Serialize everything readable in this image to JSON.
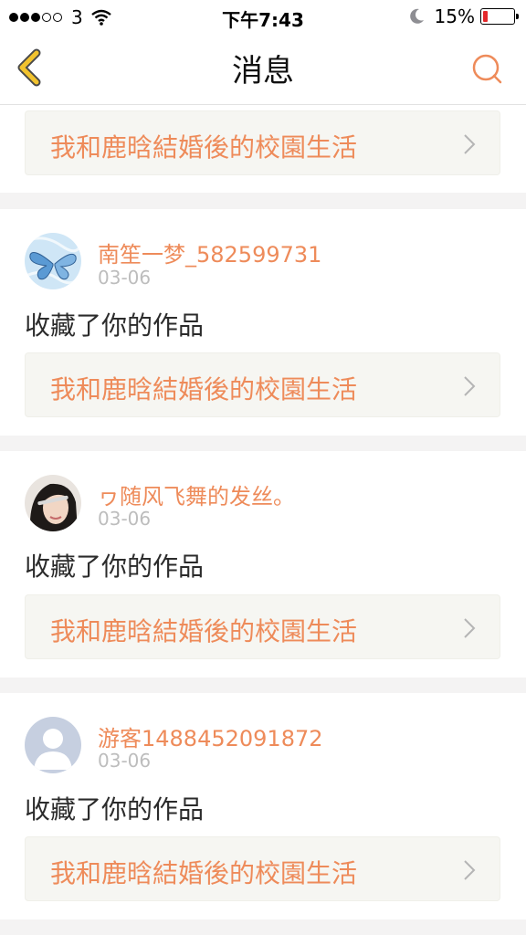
{
  "status": {
    "carrier": "3",
    "time": "下午7:43",
    "battery": "15%",
    "battery_level": 0.15
  },
  "nav": {
    "title": "消息"
  },
  "top_link": {
    "title": "我和鹿晗結婚後的校園生活"
  },
  "messages": [
    {
      "user": "南笙一梦_582599731",
      "date": "03-06",
      "action": "收藏了你的作品",
      "work": "我和鹿晗結婚後的校園生活"
    },
    {
      "user": "ヮ随风飞舞的发丝。",
      "date": "03-06",
      "action": "收藏了你的作品",
      "work": "我和鹿晗結婚後的校園生活"
    },
    {
      "user": "游客1488452091872",
      "date": "03-06",
      "action": "收藏了你的作品",
      "work": "我和鹿晗結婚後的校園生活"
    }
  ],
  "colors": {
    "accent": "#ee8b5a",
    "nav_icon": "#f2c32e"
  }
}
